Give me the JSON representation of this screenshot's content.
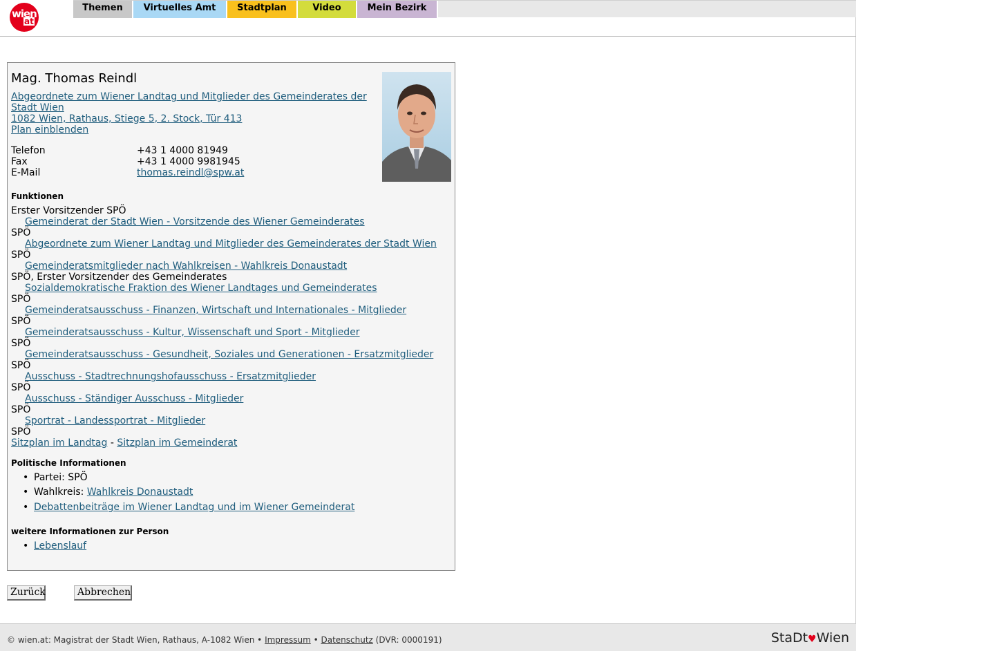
{
  "logo": {
    "text_main": "wien",
    "text_at": "at"
  },
  "nav": {
    "tabs": [
      {
        "label": "Themen",
        "color": "#c8c8c8"
      },
      {
        "label": "Virtuelles Amt",
        "color": "#a9d8f5"
      },
      {
        "label": "Stadtplan",
        "color": "#f9c01d"
      },
      {
        "label": "Video",
        "color": "#d3dc3c"
      },
      {
        "label": "Mein Bezirk",
        "color": "#c9b5d3"
      }
    ]
  },
  "person": {
    "name": "Mag. Thomas Reindl",
    "org_line1": "Abgeordnete zum Wiener Landtag und Mitglieder des Gemeinderates der",
    "org_line2": "Stadt Wien ",
    "address": "1082 Wien, Rathaus, Stiege 5, 2. Stock, Tür 413",
    "plan_link": "Plan einblenden",
    "contacts": [
      {
        "label": "Telefon",
        "value": "+43 1 4000 81949"
      },
      {
        "label": "Fax",
        "value": "+43 1 4000 9981945"
      },
      {
        "label": "E-Mail",
        "value": "thomas.reindl@spw.at"
      }
    ]
  },
  "funktionen": {
    "title": "Funktionen",
    "items": [
      {
        "role": "Erster Vorsitzender SPÖ",
        "link": "Gemeinderat der Stadt Wien - Vorsitzende des Wiener Gemeinderates"
      },
      {
        "role": "SPÖ",
        "link": "Abgeordnete zum Wiener Landtag und Mitglieder des Gemeinderates der Stadt Wien"
      },
      {
        "role": "SPÖ",
        "link": "Gemeinderatsmitglieder nach Wahlkreisen - Wahlkreis Donaustadt"
      },
      {
        "role": "SPÖ, Erster Vorsitzender des Gemeinderates",
        "link": "Sozialdemokratische Fraktion des Wiener Landtages und Gemeinderates"
      },
      {
        "role": "SPÖ",
        "link": "Gemeinderatsausschuss - Finanzen, Wirtschaft und Internationales - Mitglieder"
      },
      {
        "role": "SPÖ",
        "link": "Gemeinderatsausschuss - Kultur, Wissenschaft und Sport - Mitglieder"
      },
      {
        "role": "SPÖ",
        "link": "Gemeinderatsausschuss - Gesundheit, Soziales und Generationen - Ersatzmitglieder"
      },
      {
        "role": "SPÖ",
        "link": "Ausschuss - Stadtrechnungshofausschuss - Ersatzmitglieder"
      },
      {
        "role": "SPÖ",
        "link": "Ausschuss - Ständiger Ausschuss - Mitglieder"
      },
      {
        "role": "SPÖ",
        "link": "Sportrat - Landessportrat - Mitglieder"
      },
      {
        "role": "SPÖ",
        "link": ""
      }
    ],
    "sitzplan_landtag": "Sitzplan im Landtag",
    "sitzplan_sep": " - ",
    "sitzplan_gemeinderat": "Sitzplan im Gemeinderat"
  },
  "politisch": {
    "title": "Politische Informationen",
    "partei": "Partei: SPÖ",
    "wahlkreis_label": "Wahlkreis: ",
    "wahlkreis_link": "Wahlkreis Donaustadt",
    "debatten_link": "Debattenbeiträge im Wiener Landtag und im Wiener Gemeinderat"
  },
  "weitere": {
    "title": "weitere Informationen zur Person",
    "lebenslauf_link": "Lebenslauf"
  },
  "buttons": {
    "back": "Zurück",
    "cancel": "Abbrechen"
  },
  "footer": {
    "copyright": "© wien.at: Magistrat der Stadt Wien, Rathaus, A-1082 Wien • ",
    "impressum": "Impressum",
    "bullet": " • ",
    "datenschutz": "Datenschutz",
    "dvr": " (DVR: 0000191)",
    "stadt_logo_1": "StaDt",
    "stadt_logo_heart": "♥",
    "stadt_logo_2": "Wien"
  }
}
